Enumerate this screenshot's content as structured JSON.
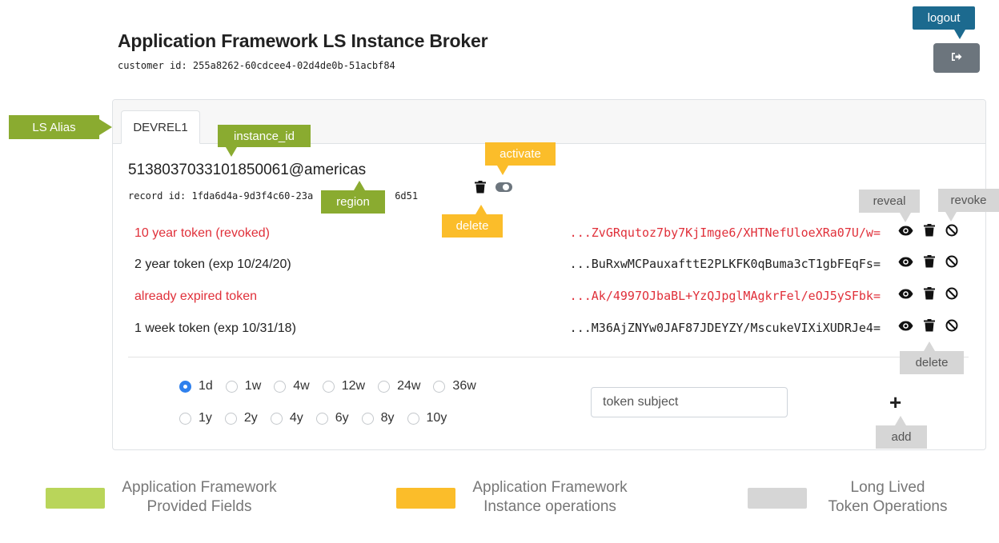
{
  "header": {
    "title": "Application Framework LS Instance Broker",
    "customer_id": "customer id: 255a8262-60cdcee4-02d4de0b-51acbf84",
    "logout_label": "logout"
  },
  "tabs": [
    {
      "label": "DEVREL1",
      "active": true
    }
  ],
  "instance": {
    "instance_id": "513803703310185006‍1@americas",
    "record_id": "record id: 1fda6d4a-9d3f4c60-23a",
    "record_id_tail": "6d51"
  },
  "tokens": [
    {
      "label": "10 year token (revoked)",
      "value": "...ZvGRqutoz7by7KjImge6/XHTNefUloeXRa07U/w=",
      "status": "revoked"
    },
    {
      "label": "2 year token (exp 10/24/20)",
      "value": "...BuRxwMCPauxafttE2PLKFK0qBuma3cT1gbFEqFs=",
      "status": "active"
    },
    {
      "label": "already expired token",
      "value": "...Ak/4997OJbaBL+YzQJpglMAgkrFel/eOJ5ySFbk=",
      "status": "expired"
    },
    {
      "label": "1 week token (exp 10/31/18)",
      "value": "...M36AjZNYw0JAF87JDEYZY/MscukeVIXiXUDRJe4=",
      "status": "active"
    }
  ],
  "durations": {
    "row1": [
      "1d",
      "1w",
      "4w",
      "12w",
      "24w",
      "36w"
    ],
    "row2": [
      "1y",
      "2y",
      "4y",
      "6y",
      "8y",
      "10y"
    ],
    "selected": "1d"
  },
  "subject_input": {
    "placeholder": "token subject",
    "value": ""
  },
  "add_label": "+",
  "annotations": {
    "ls_alias": "LS Alias",
    "instance_id": "instance_id",
    "activate": "activate",
    "region": "region",
    "delete_instance": "delete",
    "reveal": "reveal",
    "revoke": "revoke",
    "delete_token": "delete",
    "add": "add",
    "logout": "logout"
  },
  "legend": [
    {
      "line1": "Application Framework",
      "line2": "Provided Fields",
      "color": "#b9d55a"
    },
    {
      "line1": "Application Framework",
      "line2": "Instance operations",
      "color": "#fbbd2a"
    },
    {
      "line1": "Long Lived",
      "line2": "Token Operations",
      "color": "#d6d6d6"
    }
  ],
  "colors": {
    "revoked_text": "#e0303a",
    "logout_button": "#6c757d",
    "radio_selected": "#2f80ed",
    "callout_green": "#8aab30",
    "callout_yellow": "#fbbd2a",
    "callout_gray": "#d6d6d6",
    "callout_blue": "#1c6a8f"
  },
  "icons": {
    "logout": "sign-out-icon",
    "reveal": "eye-icon",
    "delete": "trash-icon",
    "revoke": "ban-icon",
    "activate": "toggle-icon"
  }
}
